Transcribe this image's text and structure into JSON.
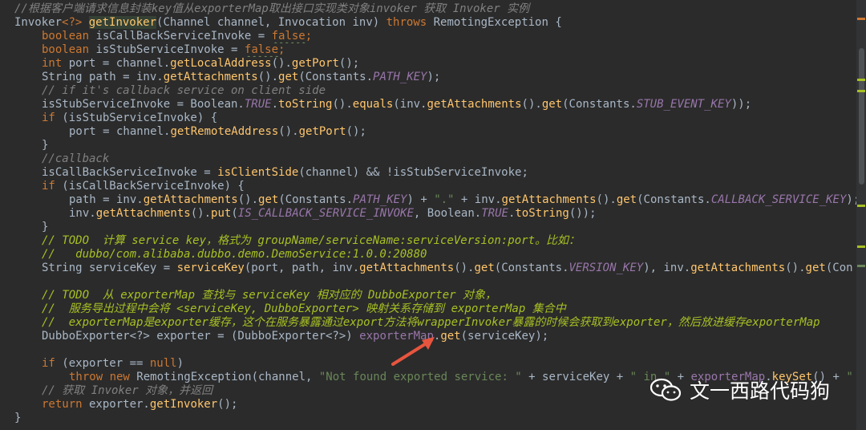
{
  "colors": {
    "background": "#2b2b2b",
    "keyword": "#cc7832",
    "method": "#ffc66d",
    "constant": "#9876aa",
    "string": "#6a8759",
    "comment": "#808080",
    "todo": "#a8c023",
    "text": "#a9b7c6",
    "arrow": "#e8553e"
  },
  "code": {
    "l1": "//根据客户端请求信息封装key值从exporterMap取出接口实现类对象invoker 获取 Invoker 实例",
    "l2": {
      "a": "Invoker",
      "b": "<?> ",
      "c": "getInvoker",
      "d": "(Channel channel, Invocation inv) ",
      "e": "throws",
      "f": " RemotingException {"
    },
    "l3": {
      "a": "boolean",
      "b": " isCallBackServiceInvoke = ",
      "c": "false",
      "d": ";"
    },
    "l4": {
      "a": "boolean",
      "b": " isStubServiceInvoke = ",
      "c": "false",
      "d": ";"
    },
    "l5": {
      "a": "int",
      "b": " port = channel.",
      "c": "getLocalAddress",
      "d": "().",
      "e": "getPort",
      "f": "();"
    },
    "l6": {
      "a": "String path = inv.",
      "b": "getAttachments",
      "c": "().",
      "d": "get",
      "e": "(Constants.",
      "f": "PATH_KEY",
      "g": ");"
    },
    "l7": "// if it's callback service on client side",
    "l8": {
      "a": "isStubServiceInvoke = Boolean.",
      "b": "TRUE",
      "c": ".",
      "d": "toString",
      "e": "().",
      "f": "equals",
      "g": "(inv.",
      "h": "getAttachments",
      "i": "().",
      "j": "get",
      "k": "(Constants.",
      "l": "STUB_EVENT_KEY",
      "m": "));"
    },
    "l9": {
      "a": "if",
      "b": " (isStubServiceInvoke) {"
    },
    "l10": {
      "a": "port = channel.",
      "b": "getRemoteAddress",
      "c": "().",
      "d": "getPort",
      "e": "();"
    },
    "l11": "}",
    "l12": "//callback",
    "l13": {
      "a": "isCallBackServiceInvoke = ",
      "b": "isClientSide",
      "c": "(channel) && !isStubServiceInvoke;"
    },
    "l14": {
      "a": "if",
      "b": " (isCallBackServiceInvoke) {"
    },
    "l15": {
      "a": "path = inv.",
      "b": "getAttachments",
      "c": "().",
      "d": "get",
      "e": "(Constants.",
      "f": "PATH_KEY",
      "g": ") + ",
      "h": "\".\"",
      "i": " + inv.",
      "j": "getAttachments",
      "k": "().",
      "l": "get",
      "m": "(Constants.",
      "n": "CALLBACK_SERVICE_KEY",
      "o": ");"
    },
    "l16": {
      "a": "inv.",
      "b": "getAttachments",
      "c": "().",
      "d": "put",
      "e": "(",
      "f": "IS_CALLBACK_SERVICE_INVOKE",
      "g": ", Boolean.",
      "h": "TRUE",
      "i": ".",
      "j": "toString",
      "k": "());"
    },
    "l17": "}",
    "l18": "// TODO  计算 service key，格式为 groupName/serviceName:serviceVersion:port。比如：",
    "l19": "//   dubbo/com.alibaba.dubbo.demo.DemoService:1.0.0:20880",
    "l20": {
      "a": "String serviceKey = ",
      "b": "serviceKey",
      "c": "(port, path, inv.",
      "d": "getAttachments",
      "e": "().",
      "f": "get",
      "g": "(Constants.",
      "h": "VERSION_KEY",
      "i": "), inv.",
      "j": "getAttachments",
      "k": "().",
      "l": "get",
      "m": "(Con"
    },
    "l21": "",
    "l22": "// TODO  从 exporterMap 查找与 serviceKey 相对应的 DubboExporter 对象，",
    "l23": "//  服务导出过程中会将 <serviceKey, DubboExporter> 映射关系存储到 exporterMap 集合中",
    "l24": "//  exporterMap是exporter缓存，这个在服务暴露通过export方法将wrapperInvoker暴露的时候会获取到exporter，然后放进缓存exporterMap",
    "l25": {
      "a": "DubboExporter<?> exporter = (DubboExporter<?>) ",
      "b": "exporterMap",
      "c": ".",
      "d": "get",
      "e": "(serviceKey);"
    },
    "l26": "",
    "l27": {
      "a": "if",
      "b": " (exporter == ",
      "c": "null",
      "d": ")"
    },
    "l28": {
      "a": "throw new",
      "b": " RemotingException(channel, ",
      "c": "\"Not found exported service: \"",
      "d": " + serviceKey + ",
      "e": "\" in \"",
      "f": " + ",
      "g": "exporterMap",
      "h": ".",
      "i": "keySet",
      "j": "() + ",
      "k": "\""
    },
    "l29": "// 获取 Invoker 对象，并返回",
    "l30": {
      "a": "return",
      "b": " exporter.",
      "c": "getInvoker",
      "d": "();"
    },
    "l31": "}"
  },
  "watermark": {
    "icon": "wechat-icon",
    "text": "文一西路代码狗"
  }
}
